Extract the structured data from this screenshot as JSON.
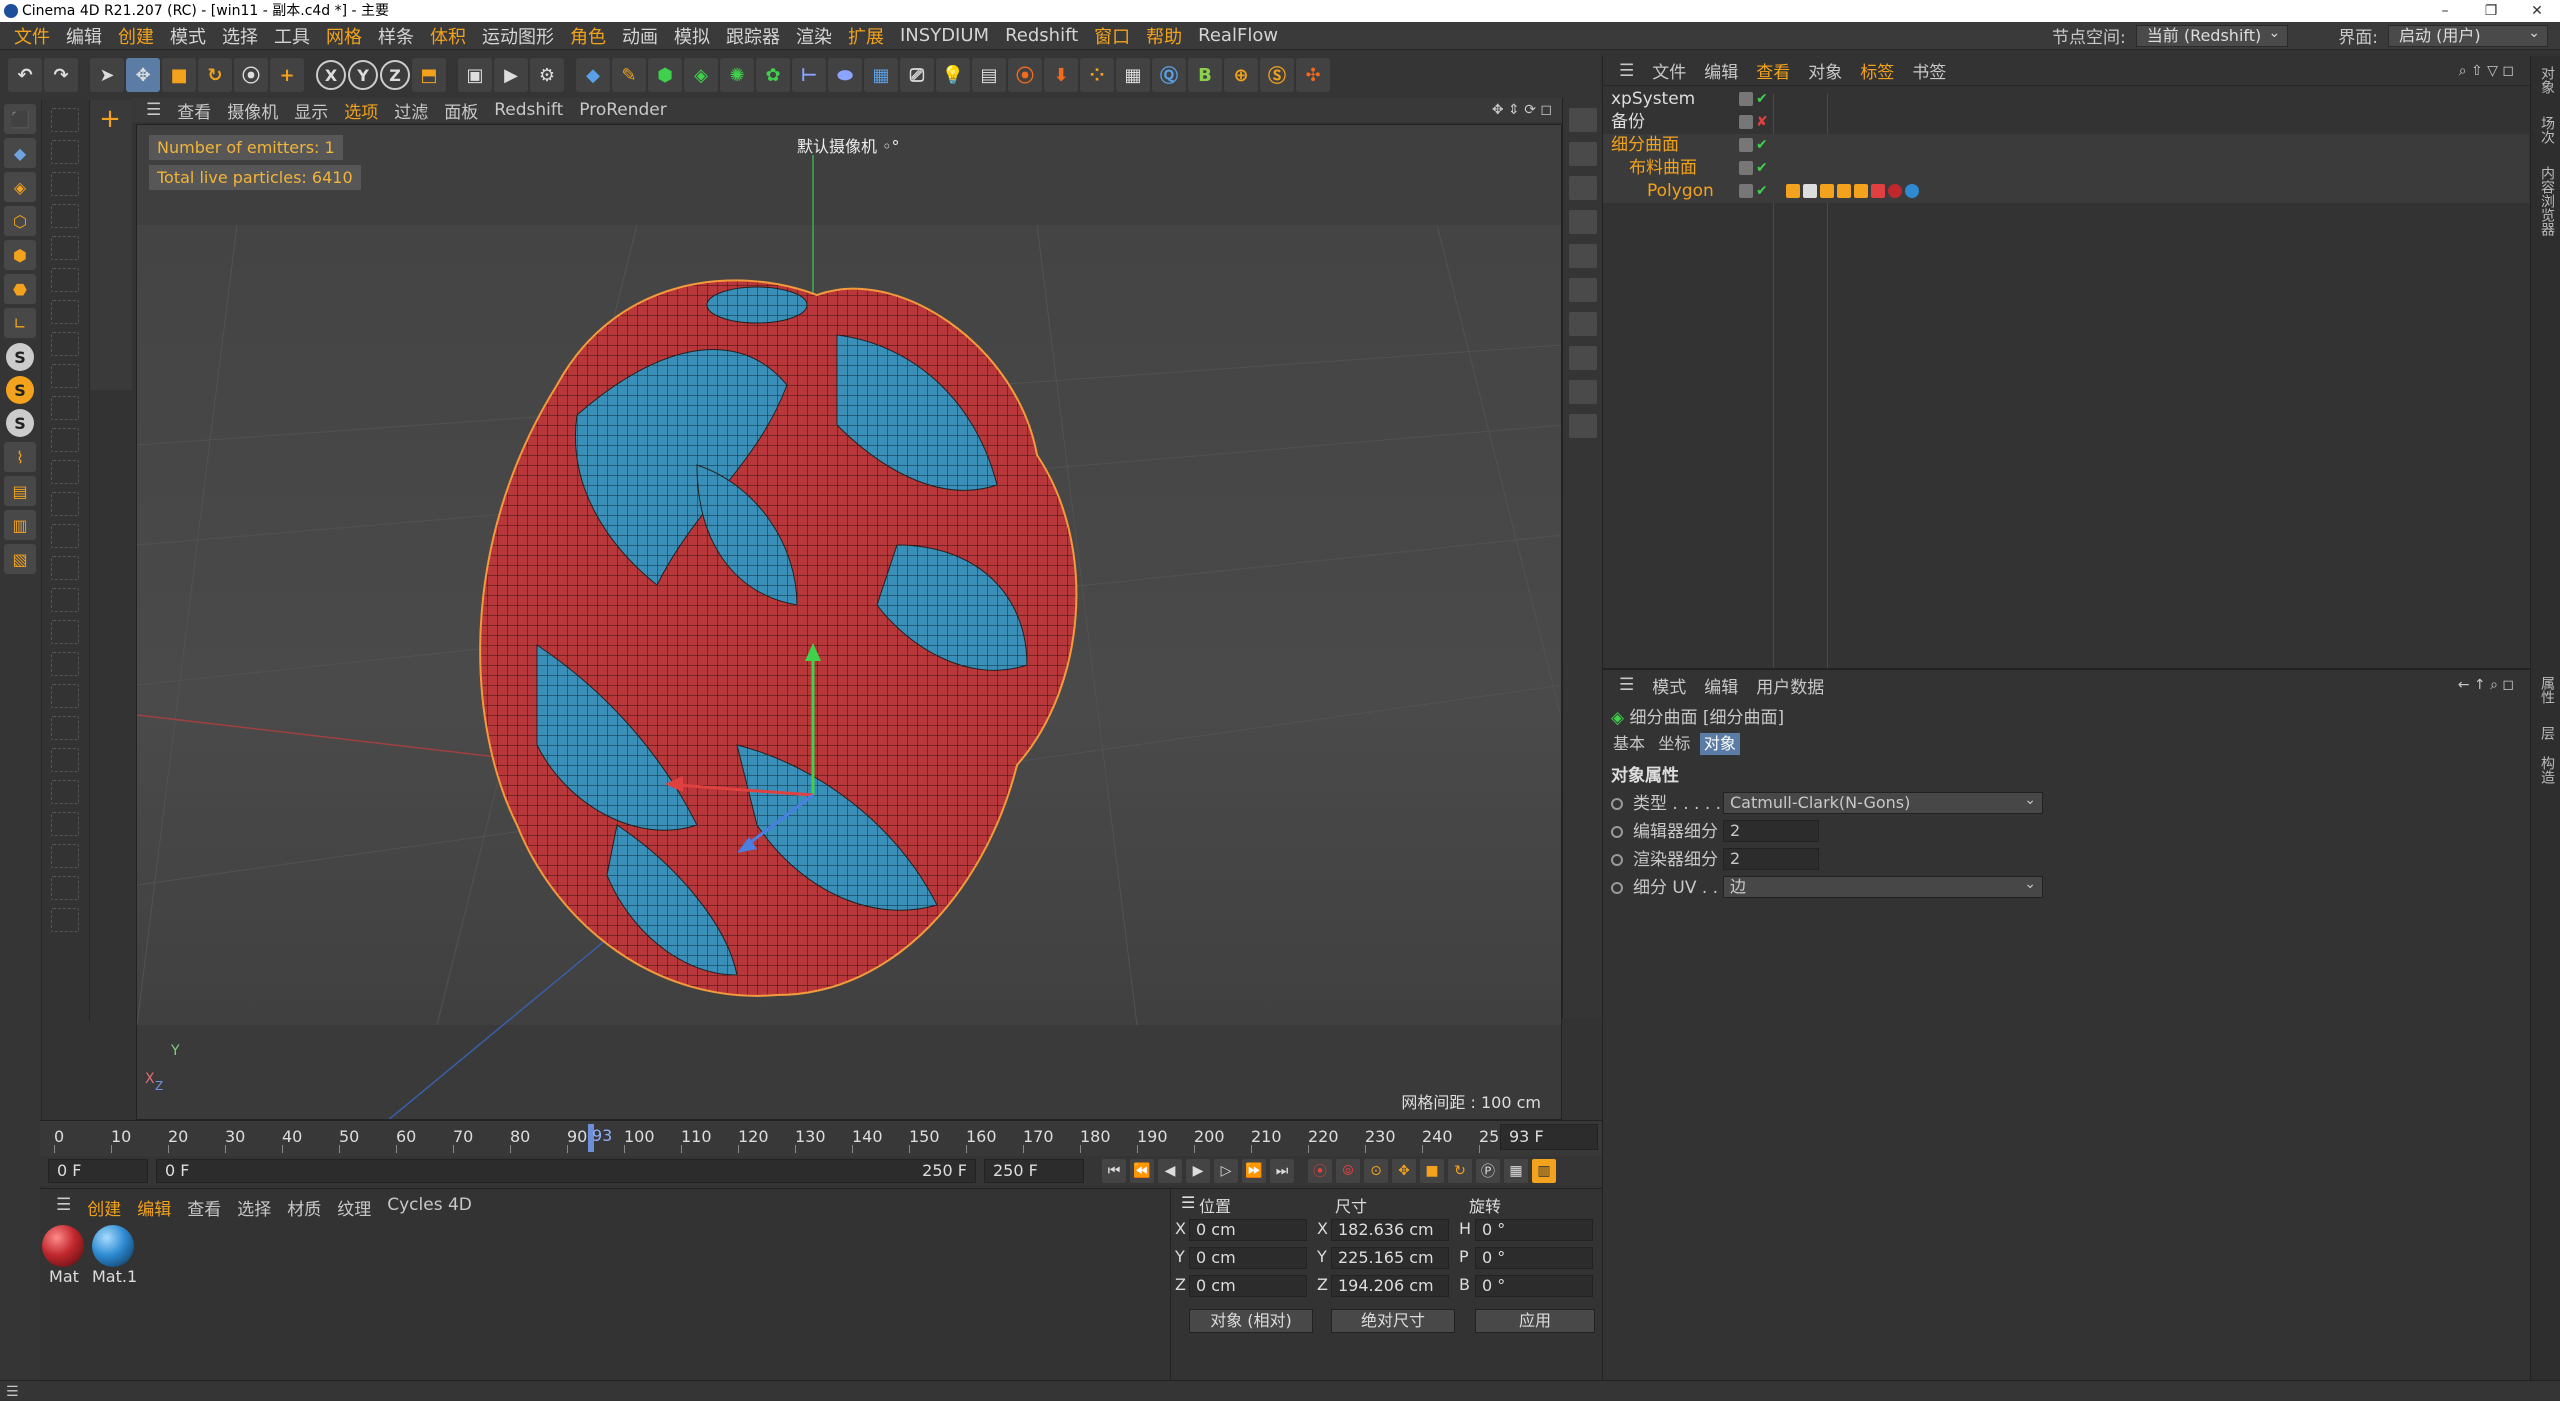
{
  "window": {
    "title": "Cinema 4D R21.207 (RC) - [win11 - 副本.c4d *] - 主要",
    "controls": [
      "–",
      "❐",
      "✕"
    ]
  },
  "menu": {
    "items": [
      "文件",
      "编辑",
      "创建",
      "模式",
      "选择",
      "工具",
      "网格",
      "样条",
      "体积",
      "运动图形",
      "角色",
      "动画",
      "模拟",
      "跟踪器",
      "渲染",
      "扩展",
      "INSYDIUM",
      "Redshift",
      "窗口",
      "帮助",
      "RealFlow"
    ],
    "node_space_label": "节点空间:",
    "node_space_value": "当前 (Redshift)",
    "layout_label": "界面:",
    "layout_value": "启动 (用户)"
  },
  "toolbar": {
    "axes": [
      "X",
      "Y",
      "Z"
    ]
  },
  "left_toolbar": {
    "s_labels": [
      "S",
      "S",
      "S"
    ]
  },
  "viewport": {
    "menu": [
      "查看",
      "摄像机",
      "显示",
      "选项",
      "过滤",
      "面板",
      "Redshift",
      "ProRender"
    ],
    "camera": "默认摄像机 ◦°",
    "info1": "Number of emitters: 1",
    "info2": "Total live particles: 6410",
    "grid_spacing": "网格间距 : 100 cm",
    "axis_y": "Y",
    "axis_x": "X",
    "axis_z": "Z",
    "colors": {
      "red": "#b8373a",
      "blue": "#3a8fb8"
    }
  },
  "timeline": {
    "ticks": [
      "0",
      "10",
      "20",
      "30",
      "40",
      "50",
      "60",
      "70",
      "80",
      "90",
      "100",
      "110",
      "120",
      "130",
      "140",
      "150",
      "160",
      "170",
      "180",
      "190",
      "200",
      "210",
      "220",
      "230",
      "240",
      "25"
    ],
    "current_marker": "93",
    "current_frame": "93 F",
    "start_field": "0 F",
    "range_start": "0 F",
    "range_end": "250 F",
    "end_field": "250 F"
  },
  "materials": {
    "menu": [
      "创建",
      "编辑",
      "查看",
      "选择",
      "材质",
      "纹理",
      "Cycles 4D"
    ],
    "items": [
      {
        "name": "Mat",
        "color": "#c0272d"
      },
      {
        "name": "Mat.1",
        "color": "#2e8bd2"
      }
    ]
  },
  "coordinates": {
    "headers": {
      "position": "位置",
      "size": "尺寸",
      "rotation": "旋转"
    },
    "rows": [
      {
        "axis": "X",
        "pos": "0 cm",
        "size_axis": "X",
        "size": "182.636 cm",
        "rot_axis": "H",
        "rot": "0 °"
      },
      {
        "axis": "Y",
        "pos": "0 cm",
        "size_axis": "Y",
        "size": "225.165 cm",
        "rot_axis": "P",
        "rot": "0 °"
      },
      {
        "axis": "Z",
        "pos": "0 cm",
        "size_axis": "Z",
        "size": "194.206 cm",
        "rot_axis": "B",
        "rot": "0 °"
      }
    ],
    "mode": "对象 (相对)",
    "size_mode": "绝对尺寸",
    "apply": "应用"
  },
  "object_manager": {
    "menu": [
      "文件",
      "编辑",
      "查看",
      "对象",
      "标签",
      "书签"
    ],
    "objects": [
      {
        "name": "xpSystem",
        "indent": 0,
        "color": "#dddddd"
      },
      {
        "name": "备份",
        "indent": 0,
        "color": "#dddddd"
      },
      {
        "name": "细分曲面",
        "indent": 0,
        "color": "#f2a21c"
      },
      {
        "name": "布料曲面",
        "indent": 1,
        "color": "#f2a21c"
      },
      {
        "name": "Polygon",
        "indent": 2,
        "color": "#f2a21c"
      }
    ]
  },
  "attributes": {
    "menu": [
      "模式",
      "编辑",
      "用户数据"
    ],
    "object_title": "细分曲面 [细分曲面]",
    "tabs": [
      "基本",
      "坐标",
      "对象"
    ],
    "active_tab": "对象",
    "section": "对象属性",
    "type_label": "类型 . . . . . . .",
    "type_value": "Catmull-Clark(N-Gons)",
    "editor_subdiv_label": "编辑器细分",
    "editor_subdiv_value": "2",
    "render_subdiv_label": "渲染器细分",
    "render_subdiv_value": "2",
    "uv_label": "细分 UV . .",
    "uv_value": "边"
  },
  "side_tabs": [
    "对象",
    "场次",
    "内容浏览器",
    "属性",
    "层",
    "构造"
  ]
}
